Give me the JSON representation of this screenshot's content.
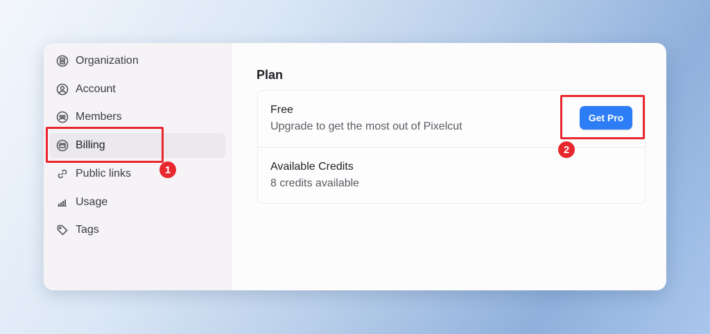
{
  "sidebar": {
    "items": [
      {
        "label": "Organization",
        "icon": "building-icon"
      },
      {
        "label": "Account",
        "icon": "user-circle-icon"
      },
      {
        "label": "Members",
        "icon": "members-icon"
      },
      {
        "label": "Billing",
        "icon": "credit-card-icon",
        "active": true
      },
      {
        "label": "Public links",
        "icon": "link-icon"
      },
      {
        "label": "Usage",
        "icon": "bar-chart-icon"
      },
      {
        "label": "Tags",
        "icon": "tag-icon"
      }
    ]
  },
  "main": {
    "section_title": "Plan",
    "plan": {
      "name": "Free",
      "description": "Upgrade to get the most out of Pixelcut",
      "cta_label": "Get Pro"
    },
    "credits": {
      "title": "Available Credits",
      "value": "8 credits available"
    }
  },
  "annotations": {
    "step1": "1",
    "step2": "2",
    "color": "#e8262e"
  },
  "colors": {
    "accent": "#2d7df6",
    "sidebar_bg": "#f5f3f6"
  }
}
